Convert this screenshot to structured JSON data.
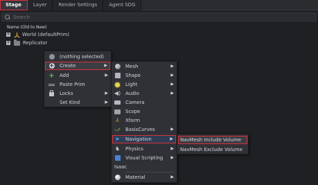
{
  "tabs": [
    {
      "label": "Stage",
      "active": true
    },
    {
      "label": "Layer",
      "active": false
    },
    {
      "label": "Render Settings",
      "active": false
    },
    {
      "label": "Agent SDG",
      "active": false
    }
  ],
  "search": {
    "placeholder": "Search",
    "icon": "search-icon"
  },
  "stage": {
    "column_header": "Name (Old to New)",
    "tree": [
      {
        "label": "World (defaultPrim)",
        "icon": "xform-icon",
        "expander": "+"
      },
      {
        "label": "Replicator",
        "icon": "folder-icon",
        "expander": "+"
      }
    ]
  },
  "context_menu": {
    "header": "(nothing selected)",
    "items": [
      {
        "label": "Create",
        "has_submenu": true,
        "highlighted": true
      },
      {
        "label": "Add",
        "has_submenu": true
      },
      {
        "label": "Paste Prim",
        "has_submenu": false
      },
      {
        "label": "Locks",
        "has_submenu": true
      },
      {
        "label": "Set Kind",
        "has_submenu": true
      }
    ]
  },
  "create_menu": {
    "items": [
      {
        "label": "Mesh",
        "icon": "mesh-icon"
      },
      {
        "label": "Shape",
        "icon": "shape-icon"
      },
      {
        "label": "Light",
        "icon": "light-icon"
      },
      {
        "label": "Audio",
        "icon": "audio-icon"
      },
      {
        "label": "Camera",
        "icon": "camera-icon"
      },
      {
        "label": "Scope",
        "icon": "scope-icon"
      },
      {
        "label": "Xform",
        "icon": "xform-icon"
      },
      {
        "label": "BasisCurves",
        "icon": "curve-icon"
      },
      {
        "label": "Navigation",
        "icon": "navigation-icon",
        "highlighted": true
      },
      {
        "label": "Physics",
        "icon": "physics-icon"
      },
      {
        "label": "Visual Scripting",
        "icon": "visual-scripting-icon"
      }
    ],
    "section_label": "Isaac",
    "material": {
      "label": "Material",
      "icon": "material-icon"
    }
  },
  "navigation_menu": {
    "items": [
      {
        "label": "NavMesh Include Volume",
        "highlighted": true
      },
      {
        "label": "NavMesh Exclude Volume"
      }
    ]
  },
  "colors": {
    "background": "#1f2023",
    "highlight_outline": "#d9303a",
    "menu_bg": "#303136"
  }
}
